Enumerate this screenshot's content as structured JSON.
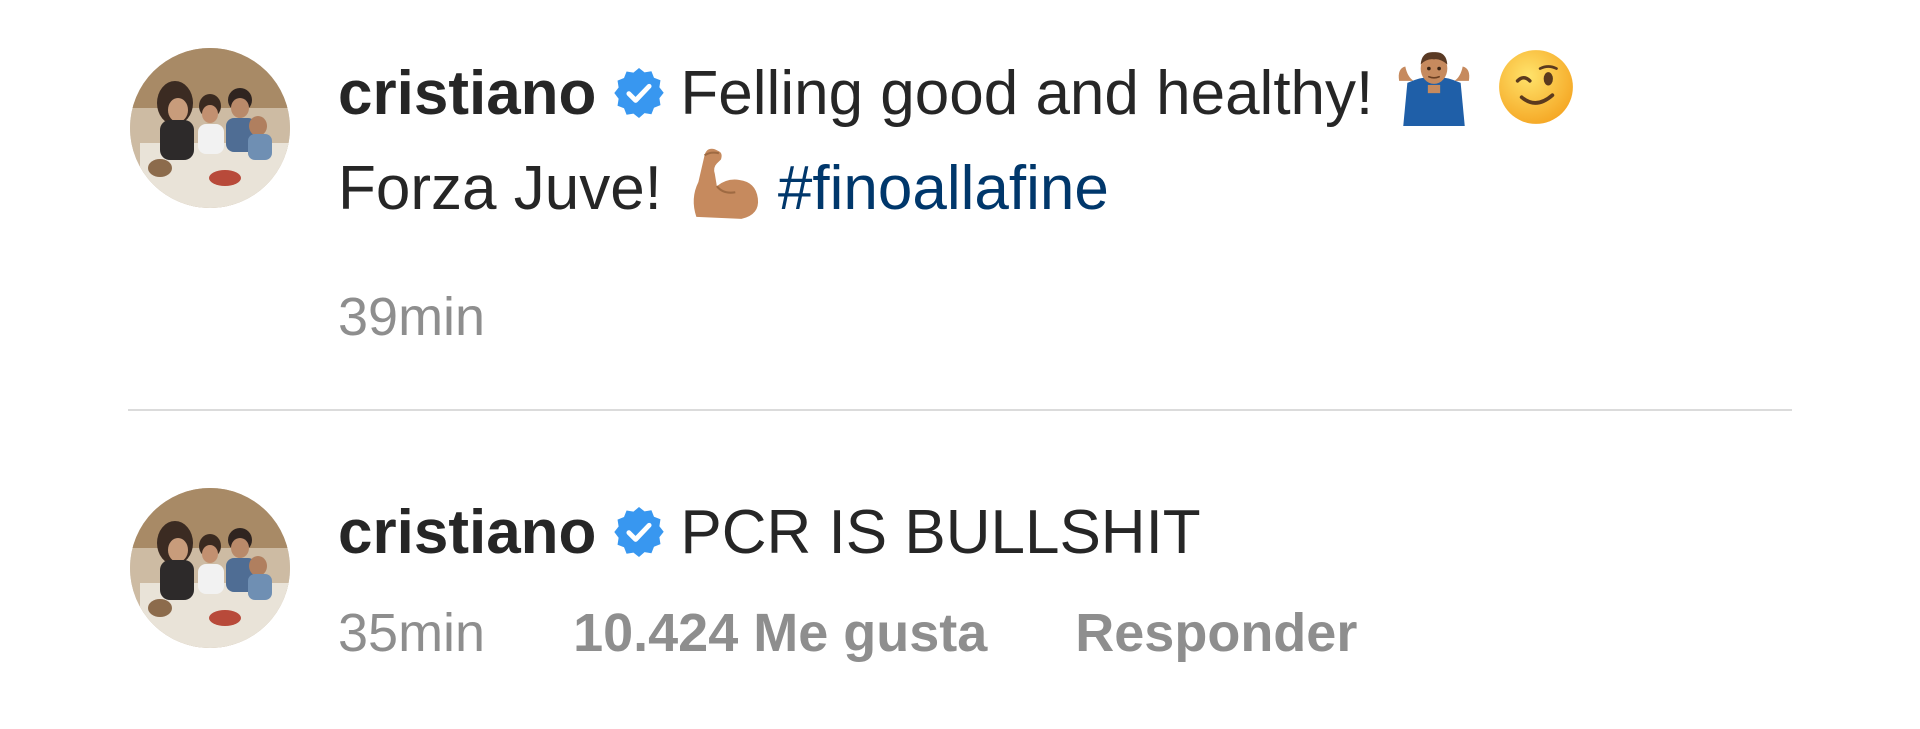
{
  "comments": [
    {
      "username": "cristiano",
      "verified": true,
      "text_line_1": "Felling good and healthy!",
      "text_line_2": "Forza Juve!",
      "hashtag": "#finoallafine",
      "emojis": [
        "man-shrugging-emoji",
        "winking-face-emoji",
        "flexed-biceps-emoji"
      ],
      "time": "39min"
    },
    {
      "username": "cristiano",
      "verified": true,
      "text": "PCR IS BULLSHIT",
      "time": "35min",
      "likes": "10.424 Me gusta",
      "reply": "Responder"
    }
  ],
  "colors": {
    "text": "#262626",
    "meta": "#8e8e8e",
    "hashtag": "#00376b",
    "verified": "#3897f0",
    "divider": "#dbdbdb"
  }
}
